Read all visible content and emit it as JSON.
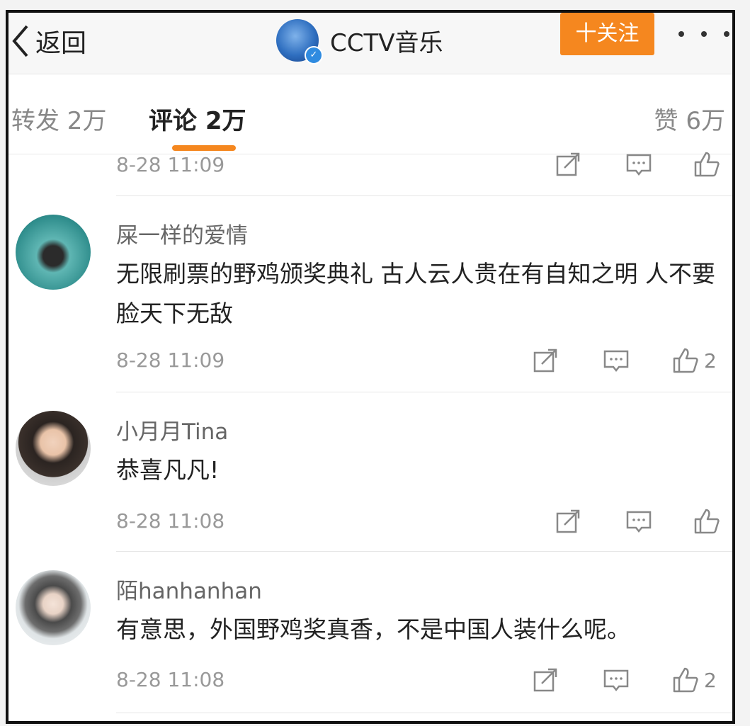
{
  "header": {
    "back_label": "返回",
    "account_name": "CCTV音乐",
    "follow_label": "十关注"
  },
  "tabs": {
    "repost": "转发 2万",
    "comment": "评论 2万",
    "like": "赞 6万"
  },
  "comments": [
    {
      "user": "",
      "text": "",
      "time": "8-28 11:09",
      "likes": ""
    },
    {
      "user": "屎一样的爱情",
      "text": "无限刷票的野鸡颁奖典礼 古人云人贵在有自知之明 人不要脸天下无敌",
      "time": "8-28 11:09",
      "likes": "2"
    },
    {
      "user": "小月月Tina",
      "text": "恭喜凡凡!",
      "time": "8-28 11:08",
      "likes": ""
    },
    {
      "user": "陌hanhanhan",
      "text": "有意思，外国野鸡奖真香，不是中国人装什么呢。",
      "time": "8-28 11:08",
      "likes": "2"
    }
  ],
  "colors": {
    "accent": "#f5871f",
    "verified": "#2f8be0"
  }
}
